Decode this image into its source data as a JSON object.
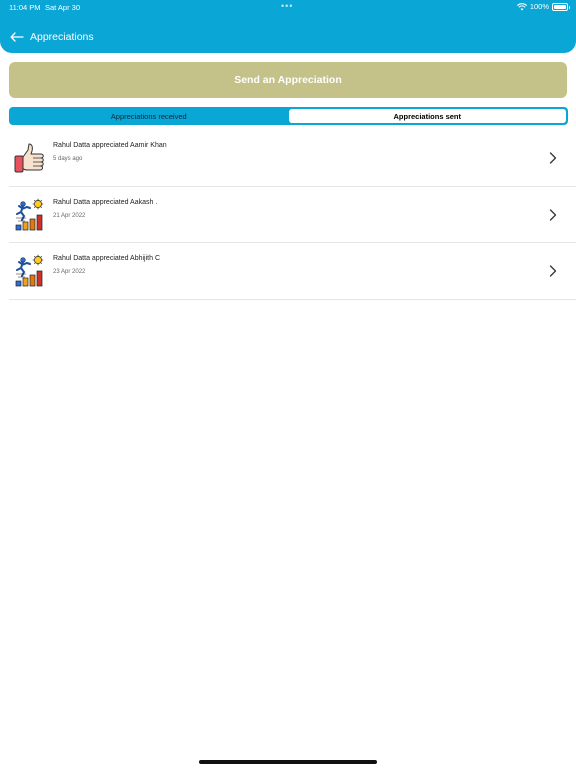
{
  "status_bar": {
    "time": "11:04 PM",
    "date": "Sat Apr 30",
    "dots": "•••",
    "battery": "100%"
  },
  "header": {
    "title": "Appreciations",
    "background_color": "#0aa6d6"
  },
  "send_button": {
    "label": "Send an Appreciation",
    "color": "#c4c189"
  },
  "tabs": {
    "received": "Appreciations received",
    "sent": "Appreciations sent",
    "active": "sent"
  },
  "appreciations": [
    {
      "text": "Rahul Datta appreciated Aamir Khan",
      "date": "5 days ago",
      "icon": "thumbs-up-icon"
    },
    {
      "text": "Rahul Datta appreciated Aakash .",
      "date": "21 Apr 2022",
      "icon": "achievement-growth-icon"
    },
    {
      "text": "Rahul Datta appreciated Abhijith C",
      "date": "23 Apr 2022",
      "icon": "achievement-growth-icon"
    }
  ]
}
